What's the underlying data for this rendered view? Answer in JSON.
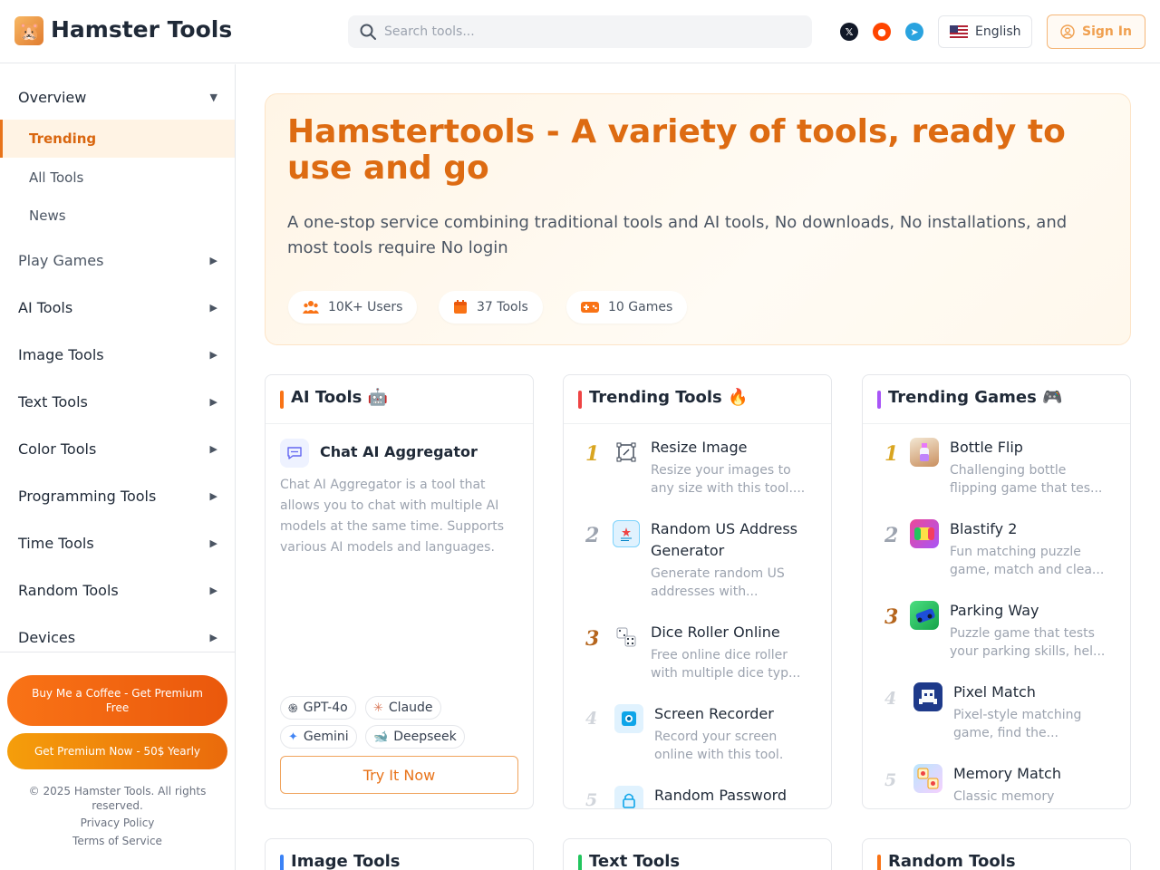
{
  "header": {
    "brand": "Hamster Tools",
    "search_placeholder": "Search tools...",
    "language": "English",
    "sign_in": "Sign In"
  },
  "sidebar": {
    "groups": [
      {
        "label": "Overview",
        "arrow": "▼"
      },
      {
        "label": "Play Games",
        "arrow": "▶"
      },
      {
        "label": "AI Tools",
        "arrow": "▶"
      },
      {
        "label": "Image Tools",
        "arrow": "▶"
      },
      {
        "label": "Text Tools",
        "arrow": "▶"
      },
      {
        "label": "Color Tools",
        "arrow": "▶"
      },
      {
        "label": "Programming Tools",
        "arrow": "▶"
      },
      {
        "label": "Time Tools",
        "arrow": "▶"
      },
      {
        "label": "Random Tools",
        "arrow": "▶"
      },
      {
        "label": "Devices",
        "arrow": "▶"
      }
    ],
    "subitems": [
      {
        "label": "Trending",
        "active": true
      },
      {
        "label": "All Tools",
        "active": false
      },
      {
        "label": "News",
        "active": false
      }
    ],
    "coffee_button": "Buy Me a Coffee - Get Premium Free",
    "premium_button": "Get Premium Now - 50$ Yearly",
    "copyright": "© 2025 Hamster Tools. All rights reserved.",
    "privacy": "Privacy Policy",
    "terms": "Terms of Service"
  },
  "hero": {
    "title": "Hamstertools - A variety of tools, ready to use and go",
    "subtitle": "A one-stop service combining traditional tools and AI tools, No downloads, No installations, and most tools require No login",
    "stats": [
      {
        "label": "10K+ Users",
        "icon": "users-icon"
      },
      {
        "label": "37 Tools",
        "icon": "calendar-icon"
      },
      {
        "label": "10 Games",
        "icon": "gamepad-icon"
      }
    ]
  },
  "ai_card": {
    "title": "AI Tools 🤖",
    "accent": "#f97316",
    "item_title": "Chat AI Aggregator",
    "item_desc": "Chat AI Aggregator is a tool that allows you to chat with multiple AI models at the same time. Supports various AI models and languages.",
    "models": [
      {
        "label": "GPT-4o",
        "icon": "openai-icon"
      },
      {
        "label": "Claude",
        "icon": "claude-icon"
      },
      {
        "label": "Gemini",
        "icon": "gemini-icon"
      },
      {
        "label": "Deepseek",
        "icon": "deepseek-icon"
      }
    ],
    "try_button": "Try It Now"
  },
  "trending_tools": {
    "title": "Trending Tools 🔥",
    "accent": "#ef4444",
    "items": [
      {
        "rank": "1",
        "title": "Resize Image",
        "desc": "Resize your images to any size with this tool...."
      },
      {
        "rank": "2",
        "title": "Random US Address Generator",
        "desc": "Generate random US addresses with..."
      },
      {
        "rank": "3",
        "title": "Dice Roller Online",
        "desc": "Free online dice roller with multiple dice typ..."
      },
      {
        "rank": "4",
        "title": "Screen Recorder",
        "desc": "Record your screen online with this tool."
      },
      {
        "rank": "5",
        "title": "Random Password",
        "desc": ""
      }
    ]
  },
  "trending_games": {
    "title": "Trending Games 🎮",
    "accent": "#a855f7",
    "items": [
      {
        "rank": "1",
        "title": "Bottle Flip",
        "desc": "Challenging bottle flipping game that tes..."
      },
      {
        "rank": "2",
        "title": "Blastify 2",
        "desc": "Fun matching puzzle game, match and clea..."
      },
      {
        "rank": "3",
        "title": "Parking Way",
        "desc": "Puzzle game that tests your parking skills, hel..."
      },
      {
        "rank": "4",
        "title": "Pixel Match",
        "desc": "Pixel-style matching game, find the..."
      },
      {
        "rank": "5",
        "title": "Memory Match",
        "desc": "Classic memory"
      }
    ]
  },
  "bottom_cards": [
    {
      "title": "Image Tools",
      "accent": "#3b82f6"
    },
    {
      "title": "Text Tools",
      "accent": "#22c55e"
    },
    {
      "title": "Random Tools",
      "accent": "#f97316"
    }
  ]
}
